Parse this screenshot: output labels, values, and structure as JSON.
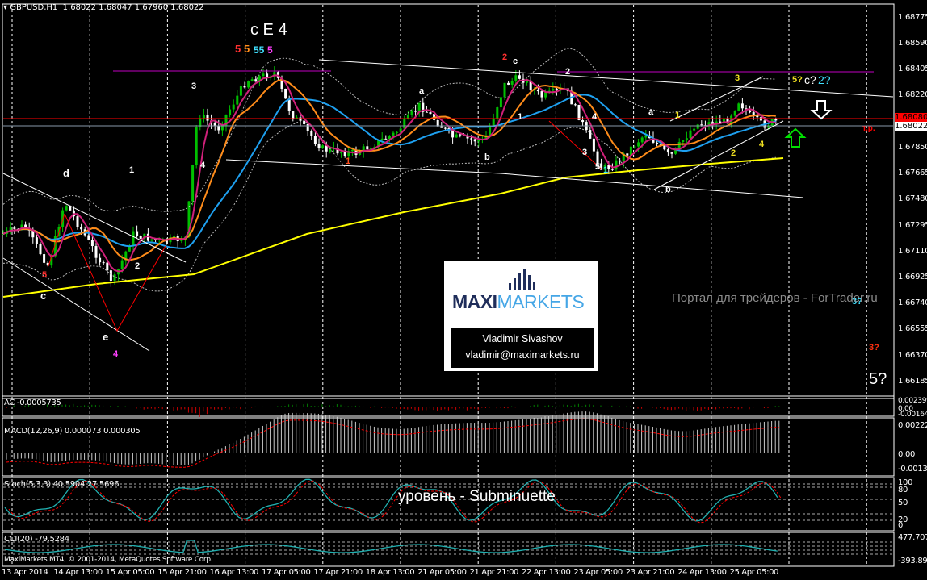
{
  "header": {
    "symbol": "GBPUSD,H1",
    "open": "1.68022",
    "high": "1.68047",
    "low": "1.67960",
    "close": "1.68022"
  },
  "price_axis": [
    "1.68775",
    "1.68590",
    "1.68405",
    "1.68220",
    "1.67850",
    "1.67665",
    "1.67480",
    "1.67295",
    "1.67110",
    "1.66925",
    "1.66740",
    "1.66555",
    "1.66370",
    "1.66185"
  ],
  "price_boxes": {
    "line": "1.68080",
    "bid": "1.68022"
  },
  "time_axis": [
    "13 Apr 2014",
    "14 Apr 13:00",
    "15 Apr 05:00",
    "15 Apr 21:00",
    "16 Apr 13:00",
    "17 Apr 05:00",
    "17 Apr 21:00",
    "18 Apr 13:00",
    "21 Apr 05:00",
    "21 Apr 21:00",
    "22 Apr 13:00",
    "23 Apr 05:00",
    "23 Apr 21:00",
    "24 Apr 13:00",
    "25 Apr 05:00"
  ],
  "waves": {
    "title": "c E 4",
    "c5a": "5",
    "c5b": "5",
    "c5c": "55",
    "c5d": "5",
    "w2o": "2",
    "wc": "c",
    "w2w": "2",
    "wa": "a",
    "wb": "b",
    "w1o": "1",
    "w1w": "1",
    "w4w": "4",
    "w3w": "3",
    "w5w": "5",
    "w1c": "1",
    "wa2": "a",
    "wb2": "b",
    "w1y": "1",
    "w3y": "3",
    "w2y": "2",
    "w4y": "4",
    "q5": "5?",
    "qc": "c?",
    "q2": "2?",
    "l3": "3",
    "l4": "4",
    "ld": "d",
    "l1": "1",
    "l2": "2",
    "l5": "5",
    "lc": "c",
    "le": "e",
    "l4m": "4",
    "tp": "т.р.",
    "q3c": "3?",
    "q3r": "3?",
    "q5w": "5?"
  },
  "watermark": "Портал для трейдеров - ForTrader.ru",
  "level_caption": "уровень - Subminuette",
  "logo": {
    "brand_left": "MAXI",
    "brand_right": "MARKETS",
    "name": "Vladimir Sivashov",
    "email": "vladimir@maximarkets.ru"
  },
  "indicators": {
    "ac": {
      "label": "AC -0.0005735",
      "axis": [
        "0.002399",
        "0.00",
        "-0.001648"
      ]
    },
    "macd": {
      "label": "MACD(12,26,9) 0.000073 0.000305",
      "axis": [
        "0.002221",
        "0.00",
        "-0.001308"
      ]
    },
    "stoch": {
      "label": "Stoch(5,3,3) 40.5904 27.5696",
      "axis": [
        "100",
        "80",
        "50",
        "20",
        "0"
      ]
    },
    "cci": {
      "label": "CCI(20) -79.5284",
      "axis": [
        "477.7074",
        "-393.8929"
      ]
    }
  },
  "footer": "MaxiMarkets MT4, © 2001-2014, MetaQuotes Software Corp.",
  "colors": {
    "bull": "#00c000",
    "bear": "#ffffff",
    "sma_blue": "#1ea0f0",
    "ema_orange": "#ff8c1a",
    "ma_magenta": "#d0207a",
    "ma200": "#ffff00",
    "res": "#ff0000",
    "magenta_line": "#c000c0"
  }
}
